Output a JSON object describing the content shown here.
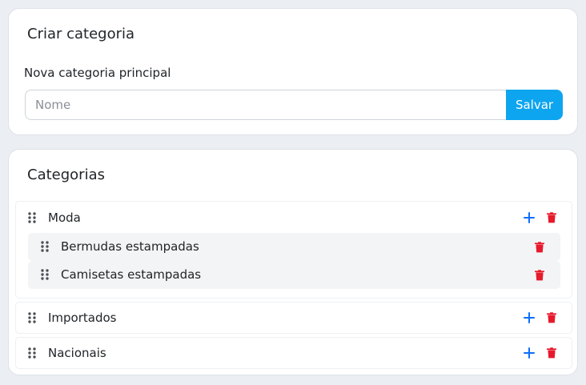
{
  "create_card": {
    "title": "Criar categoria",
    "field_label": "Nova categoria principal",
    "name_placeholder": "Nome",
    "name_value": "",
    "save_label": "Salvar"
  },
  "categories_card": {
    "title": "Categorias",
    "items": [
      {
        "label": "Moda",
        "children": [
          {
            "label": "Bermudas estampadas"
          },
          {
            "label": "Camisetas estampadas"
          }
        ]
      },
      {
        "label": "Importados",
        "children": []
      },
      {
        "label": "Nacionais",
        "children": []
      }
    ]
  },
  "colors": {
    "primary": "#0ea5f0",
    "add_icon": "#0d6efd",
    "delete_icon": "#e8192c",
    "page_bg": "#ebeef2"
  },
  "icons": {
    "drag": "grip-vertical-icon",
    "add": "plus-icon",
    "delete": "trash-icon"
  }
}
